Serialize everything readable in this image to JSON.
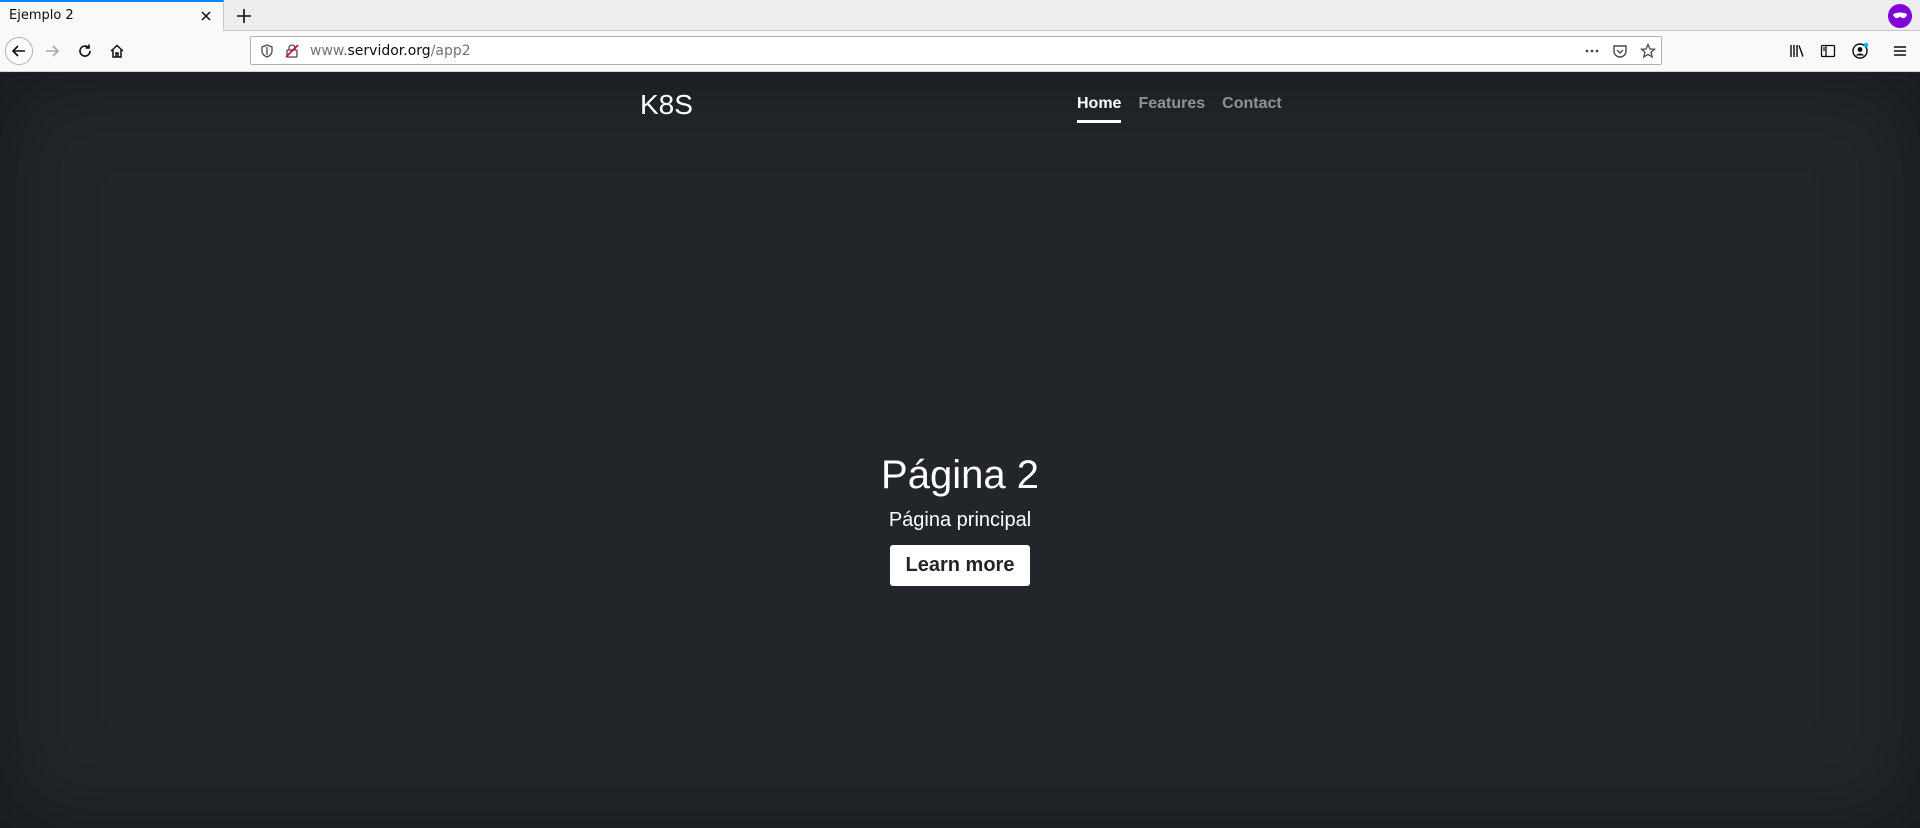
{
  "browser": {
    "tab": {
      "title": "Ejemplo 2"
    },
    "url": {
      "prefix": "www.",
      "host": "servidor.org",
      "path": "/app2"
    }
  },
  "page": {
    "brand": "K8S",
    "nav": [
      {
        "label": "Home",
        "active": true
      },
      {
        "label": "Features",
        "active": false
      },
      {
        "label": "Contact",
        "active": false
      }
    ],
    "hero": {
      "title": "Página 2",
      "lead": "Página principal",
      "button": "Learn more"
    }
  }
}
